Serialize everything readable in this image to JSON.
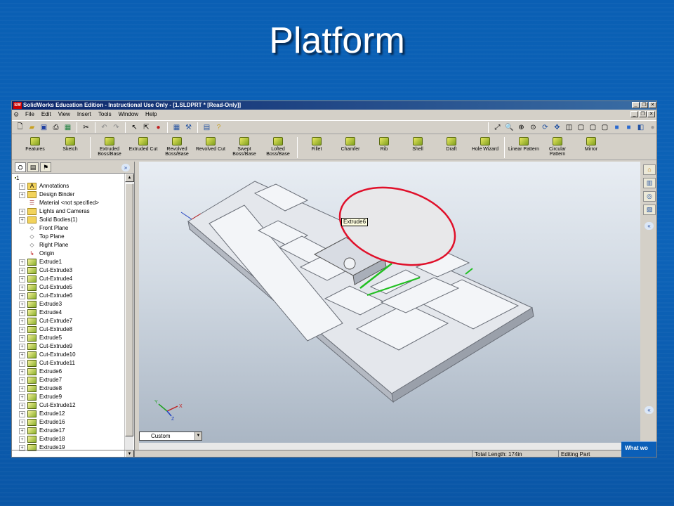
{
  "slide": {
    "title": "Platform"
  },
  "window": {
    "title": "SolidWorks Education Edition - Instructional Use Only - [1.SLDPRT * [Read-Only]]",
    "logo": "SW",
    "buttons": [
      "_",
      "❐",
      "✕"
    ]
  },
  "menu": {
    "items": [
      "File",
      "Edit",
      "View",
      "Insert",
      "Tools",
      "Window",
      "Help"
    ]
  },
  "commands": [
    {
      "label": "Features",
      "icon": "features-icon"
    },
    {
      "label": "Sketch",
      "icon": "sketch-icon"
    },
    {
      "label": "Extruded Boss/Base",
      "icon": "extrude-boss-icon"
    },
    {
      "label": "Extruded Cut",
      "icon": "extrude-cut-icon"
    },
    {
      "label": "Revolved Boss/Base",
      "icon": "revolve-boss-icon"
    },
    {
      "label": "Revolved Cut",
      "icon": "revolve-cut-icon"
    },
    {
      "label": "Swept Boss/Base",
      "icon": "swept-boss-icon"
    },
    {
      "label": "Lofted Boss/Base",
      "icon": "loft-boss-icon"
    },
    {
      "label": "Fillet",
      "icon": "fillet-icon"
    },
    {
      "label": "Chamfer",
      "icon": "chamfer-icon"
    },
    {
      "label": "Rib",
      "icon": "rib-icon"
    },
    {
      "label": "Shell",
      "icon": "shell-icon"
    },
    {
      "label": "Draft",
      "icon": "draft-icon"
    },
    {
      "label": "Hole Wizard",
      "icon": "hole-wizard-icon"
    },
    {
      "label": "Linear Pattern",
      "icon": "linear-pattern-icon"
    },
    {
      "label": "Circular Pattern",
      "icon": "circular-pattern-icon"
    },
    {
      "label": "Mirror",
      "icon": "mirror-icon"
    }
  ],
  "tree": {
    "root": "1",
    "items": [
      {
        "label": "Annotations",
        "type": "annotation",
        "expand": "+"
      },
      {
        "label": "Design Binder",
        "type": "binder",
        "expand": "+"
      },
      {
        "label": "Material <not specified>",
        "type": "material",
        "expand": ""
      },
      {
        "label": "Lights and Cameras",
        "type": "folder",
        "expand": "+"
      },
      {
        "label": "Solid Bodies(1)",
        "type": "folder",
        "expand": "+"
      },
      {
        "label": "Front Plane",
        "type": "plane",
        "expand": ""
      },
      {
        "label": "Top Plane",
        "type": "plane",
        "expand": ""
      },
      {
        "label": "Right Plane",
        "type": "plane",
        "expand": ""
      },
      {
        "label": "Origin",
        "type": "origin",
        "expand": ""
      },
      {
        "label": "Extrude1",
        "type": "feat",
        "expand": "+"
      },
      {
        "label": "Cut-Extrude3",
        "type": "feat",
        "expand": "+"
      },
      {
        "label": "Cut-Extrude4",
        "type": "feat",
        "expand": "+"
      },
      {
        "label": "Cut-Extrude5",
        "type": "feat",
        "expand": "+"
      },
      {
        "label": "Cut-Extrude6",
        "type": "feat",
        "expand": "+"
      },
      {
        "label": "Extrude3",
        "type": "feat",
        "expand": "+"
      },
      {
        "label": "Extrude4",
        "type": "feat",
        "expand": "+"
      },
      {
        "label": "Cut-Extrude7",
        "type": "feat",
        "expand": "+"
      },
      {
        "label": "Cut-Extrude8",
        "type": "feat",
        "expand": "+"
      },
      {
        "label": "Extrude5",
        "type": "feat",
        "expand": "+"
      },
      {
        "label": "Cut-Extrude9",
        "type": "feat",
        "expand": "+"
      },
      {
        "label": "Cut-Extrude10",
        "type": "feat",
        "expand": "+"
      },
      {
        "label": "Cut-Extrude11",
        "type": "feat",
        "expand": "+"
      },
      {
        "label": "Extrude6",
        "type": "feat",
        "expand": "+"
      },
      {
        "label": "Extrude7",
        "type": "feat",
        "expand": "+"
      },
      {
        "label": "Extrude8",
        "type": "feat",
        "expand": "+"
      },
      {
        "label": "Extrude9",
        "type": "feat",
        "expand": "+"
      },
      {
        "label": "Cut-Extrude12",
        "type": "feat",
        "expand": "+"
      },
      {
        "label": "Extrude12",
        "type": "feat",
        "expand": "+"
      },
      {
        "label": "Extrude16",
        "type": "feat",
        "expand": "+"
      },
      {
        "label": "Extrude17",
        "type": "feat",
        "expand": "+"
      },
      {
        "label": "Extrude18",
        "type": "feat",
        "expand": "+"
      },
      {
        "label": "Extrude19",
        "type": "feat",
        "expand": "+"
      }
    ]
  },
  "viewport": {
    "tooltip": "Extrude6",
    "view_combo": "Custom",
    "triad": {
      "x": "X",
      "y": "Y",
      "z": "Z"
    }
  },
  "status": {
    "total_length": "Total Length: 174in",
    "mode": "Editing Part",
    "help_panel": "What wo"
  },
  "colors": {
    "slide_bg": "#0a5fb4",
    "selection_red": "#e0102a",
    "highlight_green": "#20c020",
    "title_bar": "#0a246a"
  }
}
